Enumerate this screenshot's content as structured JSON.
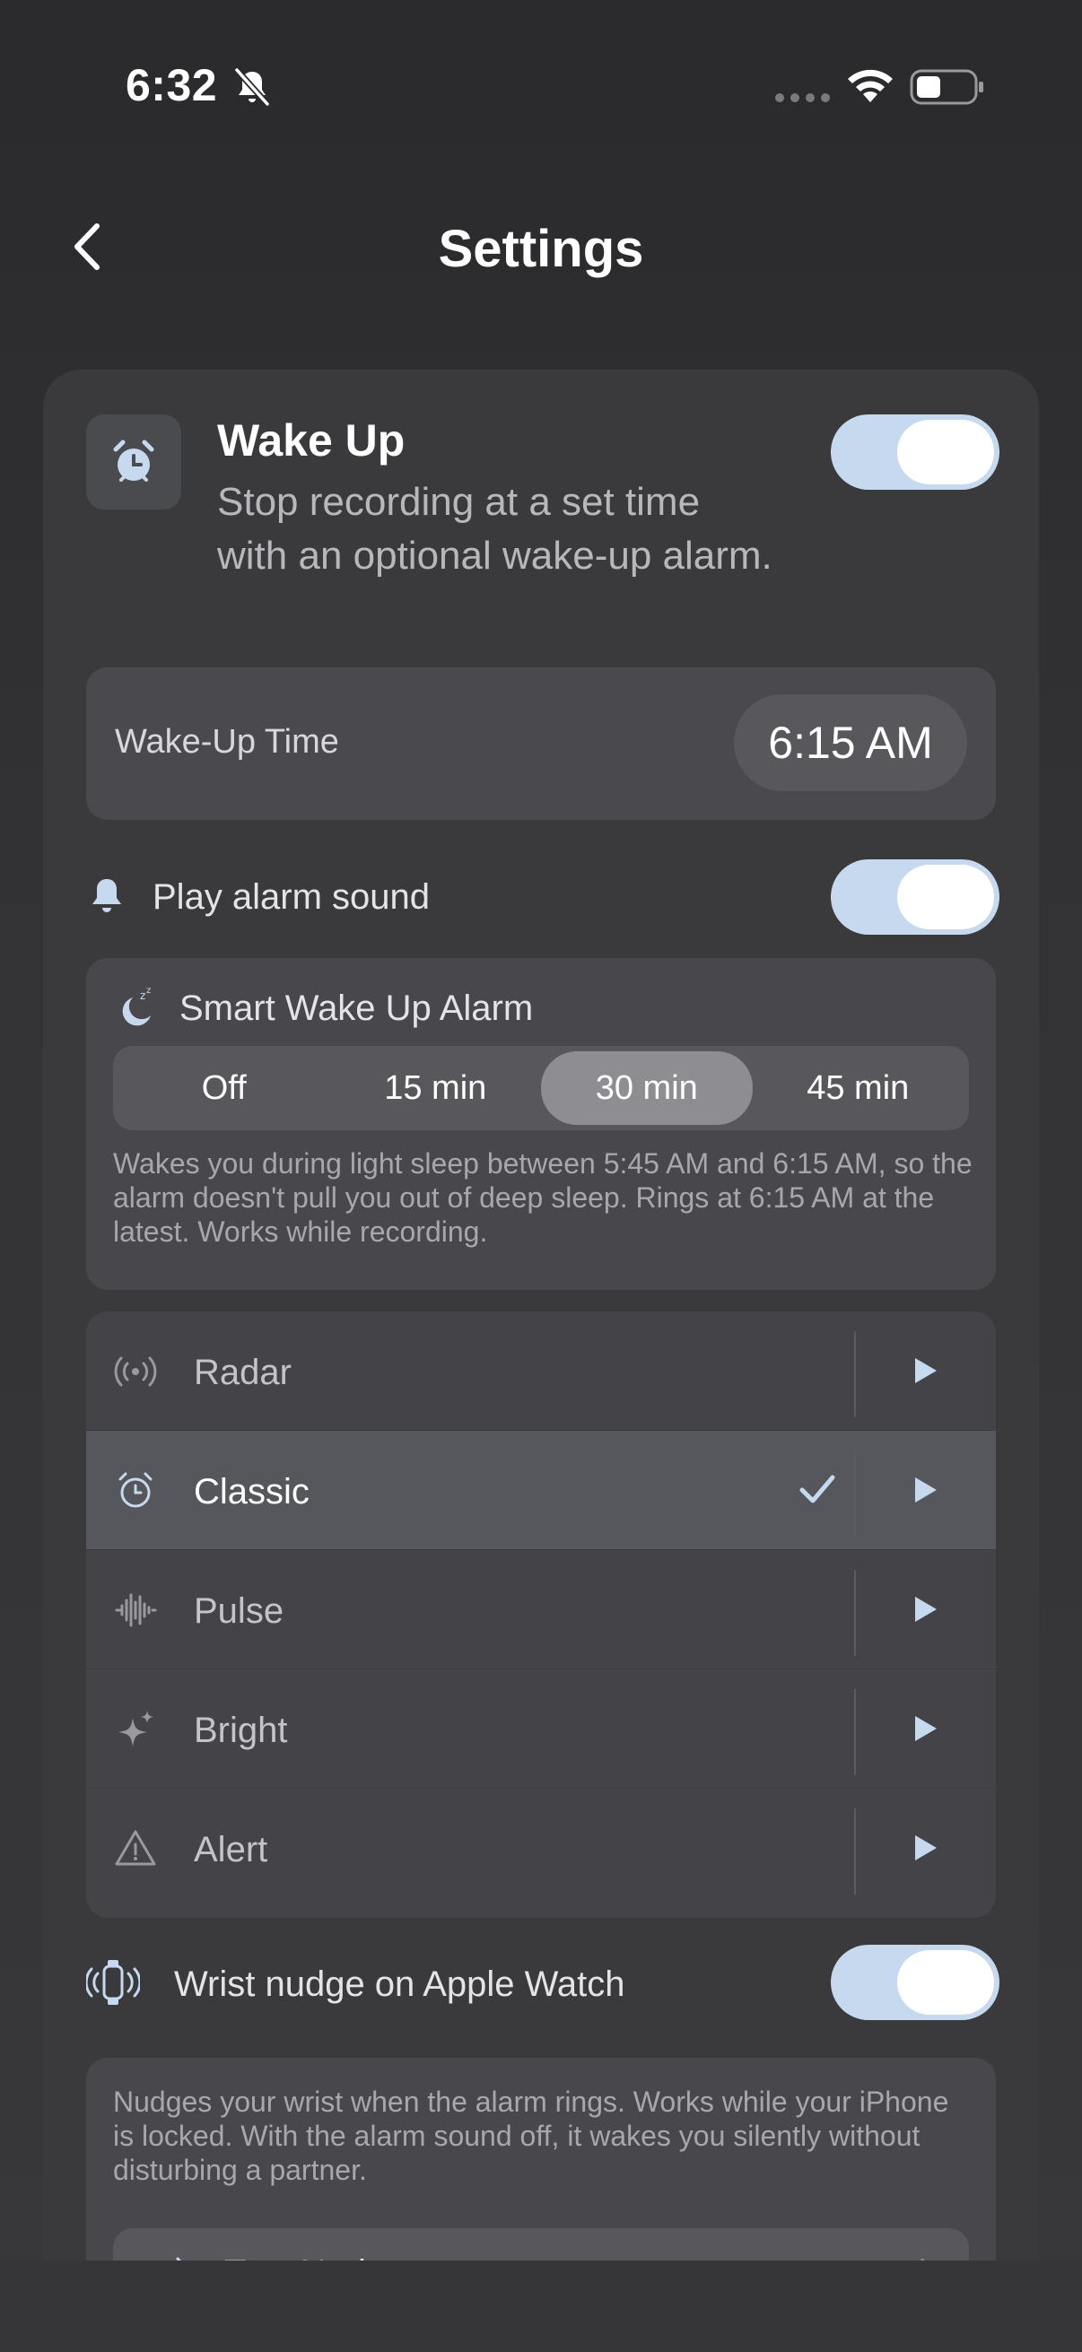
{
  "status_bar": {
    "time": "6:32"
  },
  "nav": {
    "title": "Settings"
  },
  "wake_up": {
    "title": "Wake Up",
    "description": "Stop recording at a set time with an optional wake-up alarm.",
    "enabled": true
  },
  "wake_time": {
    "label": "Wake-Up Time",
    "value": "6:15 AM"
  },
  "play_sound": {
    "label": "Play alarm sound",
    "enabled": true
  },
  "smart_wake": {
    "title": "Smart Wake Up Alarm",
    "options": [
      "Off",
      "15 min",
      "30 min",
      "45 min"
    ],
    "selected": "30 min",
    "note": "Wakes you during light sleep between 5:45 AM and 6:15 AM, so the alarm doesn't pull you out of deep sleep. Rings at 6:15 AM at the latest. Works while recording."
  },
  "sounds": [
    {
      "label": "Radar",
      "icon": "radar-icon",
      "selected": false
    },
    {
      "label": "Classic",
      "icon": "alarm-clock-icon",
      "selected": true
    },
    {
      "label": "Pulse",
      "icon": "waveform-icon",
      "selected": false
    },
    {
      "label": "Bright",
      "icon": "sparkle-icon",
      "selected": false
    },
    {
      "label": "Alert",
      "icon": "warning-triangle-icon",
      "selected": false
    }
  ],
  "wrist_nudge": {
    "label": "Wrist nudge on Apple Watch",
    "enabled": true,
    "note": "Nudges your wrist when the alarm rings. Works while your iPhone is locked. With the alarm sound off, it wakes you silently without disturbing a partner.",
    "test_label": "Test Nudge"
  },
  "colors": {
    "toggle_on": "#c6d9ef",
    "icon_accent": "#c6d9ef",
    "card_bg": "#3a3a3c"
  }
}
